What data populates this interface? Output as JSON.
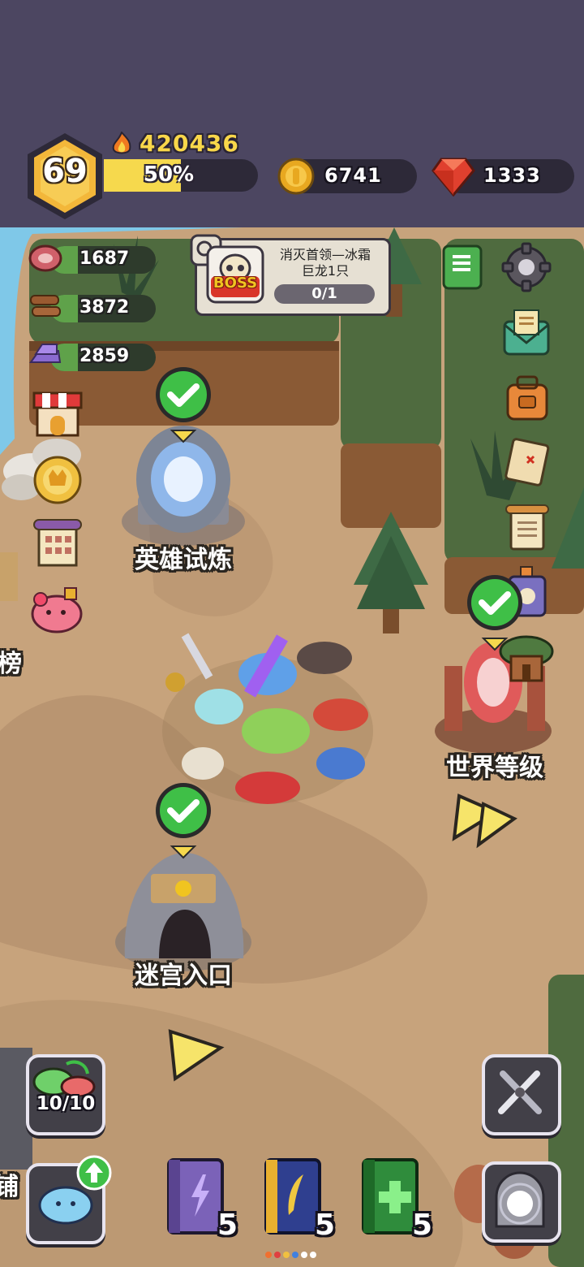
{
  "player": {
    "level": "69",
    "power": "420436",
    "xp_percent": "50%",
    "xp_fraction": 0.5
  },
  "currencies": {
    "gold": "6741",
    "gems": "1333"
  },
  "resources": {
    "meat": "1687",
    "wood": "3872",
    "ore": "2859"
  },
  "quest": {
    "title_line1": "消灭首领—冰霜",
    "title_line2": "巨龙1只",
    "progress": "0/1",
    "badge": "BOSS"
  },
  "locations": {
    "hero_trial": "英雄试炼",
    "world_level": "世界等级",
    "maze_entrance": "迷宫入口"
  },
  "left_edge": {
    "partial_top": "榜",
    "partial_bottom": "铺"
  },
  "slime_capacity": "10/10",
  "books": [
    {
      "name": "lightning-book",
      "count": "5",
      "color": "#7b62b8"
    },
    {
      "name": "feather-book",
      "count": "5",
      "color": "#2f3f8f"
    },
    {
      "name": "heal-book",
      "count": "5",
      "color": "#2f8c3c"
    }
  ],
  "colors": {
    "header_bg": "#4c4661",
    "xp_fill": "#f6d94d",
    "map_ground": "#c7a37c",
    "check_green": "#3fbf47"
  }
}
